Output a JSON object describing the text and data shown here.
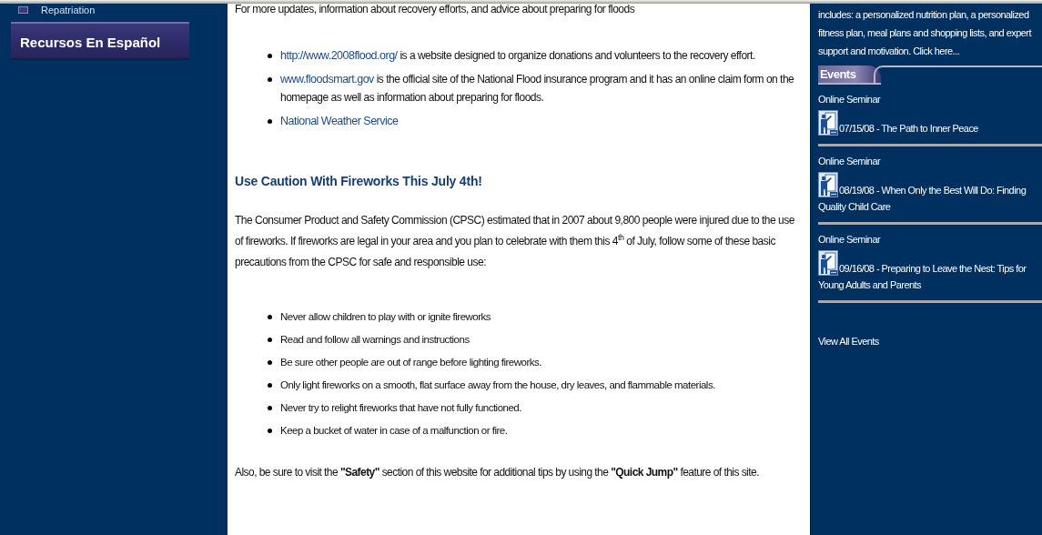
{
  "left_nav": {
    "items": [
      {
        "label": "Repatriation"
      }
    ],
    "spanish_button": "Recursos En Español"
  },
  "main": {
    "intro": "For more updates, information about recovery efforts, and advice about preparing for floods",
    "resources": [
      {
        "link": "http://www.2008flood.org/",
        "text": " is a website designed to organize donations and volunteers to the recovery effort."
      },
      {
        "link": "www.floodsmart.gov",
        "text": " is the official site of the National Flood insurance program and it has an online claim form on the homepage as well as information about preparing for floods."
      },
      {
        "link": "National Weather Service"
      }
    ],
    "heading": "Use Caution With Fireworks This July 4th!",
    "paragraph": "The Consumer Product and Safety Commission (CPSC) estimated that in 2007 about 9,800 people were injured due to the use of fireworks. If fireworks are legal in your area and you plan to celebrate with them this 4$^{th}$ of July, follow some of these basic precautions from the CPSC for safe and responsible use:",
    "precautions": [
      "Never allow children to play with or ignite fireworks",
      "Read and follow all warnings and instructions",
      "Be sure other people are out of range before lighting fireworks.",
      "Only light fireworks on a smooth, flat surface away from the house, dry leaves, and flammable materials.",
      "Never try to relight fireworks that have not fully functioned.",
      "Keep a bucket of water in case of a malfunction or fire."
    ],
    "closing": "Also, be sure to visit the **\"Safety\"** section of this website for additional tips by using the **\"Quick Jump\"** feature of this site."
  },
  "sidebar": {
    "promo": "includes: a personalized nutrition plan, a personalized fitness plan, meal plans and shopping lists, and expert support and motivation. Click here...",
    "events_title": "Events",
    "events": [
      {
        "type": "Online Seminar",
        "title": "07/15/08 - The Path to Inner Peace"
      },
      {
        "type": "Online Seminar",
        "title": "08/19/08 - When Only the Best Will Do: Finding Quality Child Care"
      },
      {
        "type": "Online Seminar",
        "title": "09/16/08 - Preparing to Leave the Nest: Tips for Young Adults and Parents"
      }
    ],
    "view_all": "View All Events"
  }
}
